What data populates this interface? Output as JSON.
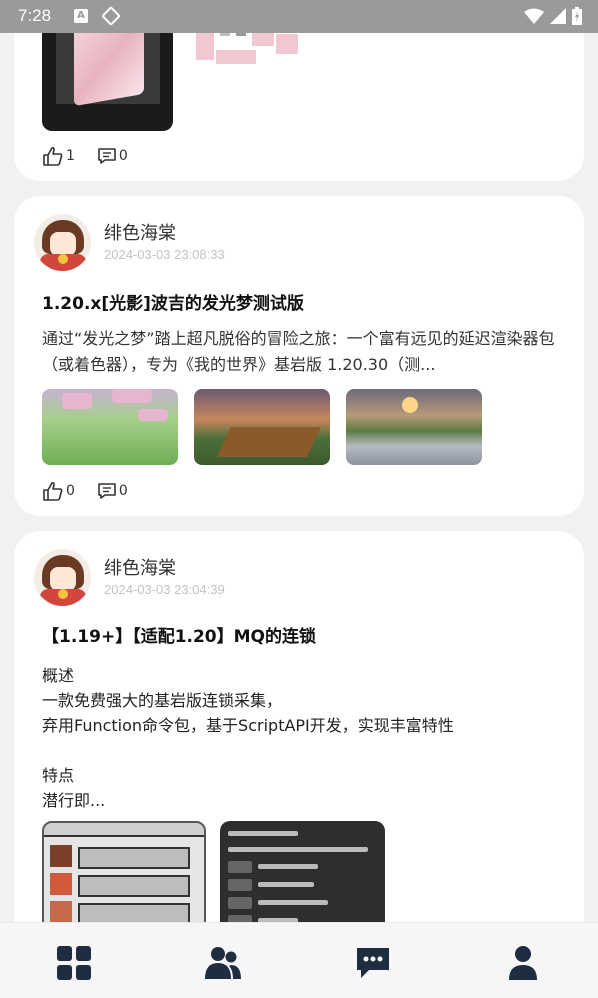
{
  "status_bar": {
    "time": "7:28"
  },
  "posts": [
    {
      "likes": "1",
      "comments": "0"
    },
    {
      "author": "绯色海棠",
      "date": "2024-03-03 23:08:33",
      "title": "1.20.x[光影]波吉的发光梦测试版",
      "description": "通过“发光之梦”踏上超凡脱俗的冒险之旅：一个富有远见的延迟渲染器包（或着色器），专为《我的世界》基岩版 1.20.30（测...",
      "likes": "0",
      "comments": "0"
    },
    {
      "author": "绯色海棠",
      "date": "2024-03-03 23:04:39",
      "title": "【1.19+】【适配1.20】MQ的连锁",
      "body": {
        "line1": "概述",
        "line2": "一款免费强大的基岩版连锁采集，",
        "line3": "弃用Function命令包，基于ScriptAPI开发，实现丰富特性",
        "line4": "特点",
        "line5": "潜行即..."
      }
    }
  ],
  "nav": {
    "items": [
      {
        "icon": "grid-icon"
      },
      {
        "icon": "users-icon"
      },
      {
        "icon": "chat-icon"
      },
      {
        "icon": "profile-icon"
      }
    ],
    "color": "#1f2d40"
  }
}
